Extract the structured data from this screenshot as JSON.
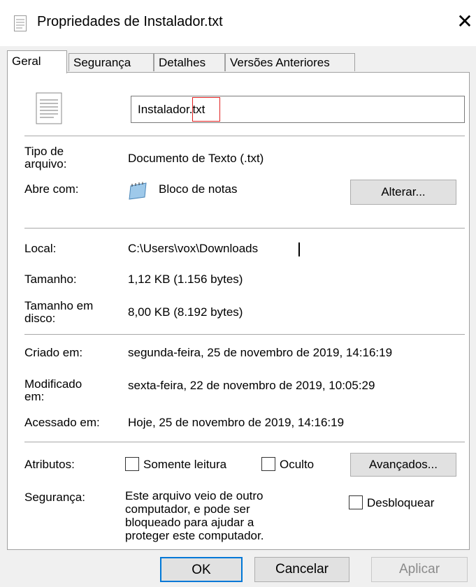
{
  "window": {
    "title": "Propriedades de Instalador.txt",
    "close_label": "✕"
  },
  "tabs": [
    {
      "label": "Geral",
      "active": true
    },
    {
      "label": "Segurança"
    },
    {
      "label": "Detalhes"
    },
    {
      "label": "Versões Anteriores"
    }
  ],
  "general": {
    "file_name": "Instalador.txt",
    "file_type_label_1": "Tipo de",
    "file_type_label_2": "arquivo:",
    "file_type_value": "Documento de Texto (.txt)",
    "opens_with_label": "Abre com:",
    "opens_with_value": "Bloco de notas",
    "change_button": "Alterar...",
    "location_label": "Local:",
    "location_value": "C:\\Users\\vox\\Downloads",
    "size_label": "Tamanho:",
    "size_value": "1,12 KB (1.156 bytes)",
    "disk_size_label_1": "Tamanho em",
    "disk_size_label_2": "disco:",
    "disk_size_value": "8,00 KB (8.192 bytes)",
    "created_label": "Criado em:",
    "created_value": "segunda-feira, 25 de novembro de 2019, 14:16:19",
    "modified_label_1": "Modificado",
    "modified_label_2": "em:",
    "modified_value": "sexta-feira, 22 de novembro de 2019, 10:05:29",
    "accessed_label": "Acessado em:",
    "accessed_value": "Hoje, 25 de novembro de 2019, 14:16:19",
    "attributes_label": "Atributos:",
    "readonly_label": "Somente leitura",
    "hidden_label": "Oculto",
    "advanced_button": "Avançados...",
    "security_label": "Segurança:",
    "security_text_1": "Este arquivo veio de outro",
    "security_text_2": "computador, e pode ser",
    "security_text_3": "bloqueado para ajudar a",
    "security_text_4": "proteger este computador.",
    "unblock_label": "Desbloquear"
  },
  "footer": {
    "ok": "OK",
    "cancel": "Cancelar",
    "apply": "Aplicar"
  }
}
